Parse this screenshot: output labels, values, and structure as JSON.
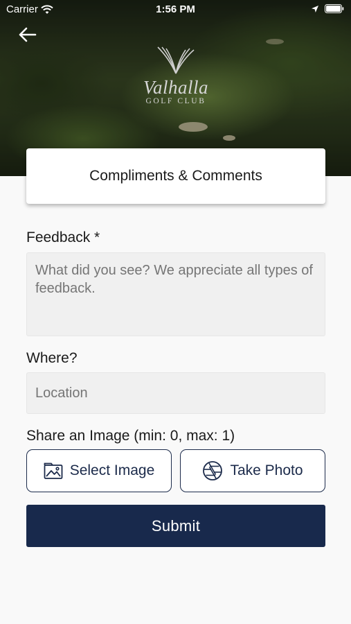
{
  "status_bar": {
    "carrier": "Carrier",
    "time": "1:56 PM"
  },
  "header": {
    "back_icon": "arrow-left-icon",
    "logo_name": "Valhalla",
    "logo_sub": "GOLF CLUB"
  },
  "page": {
    "title": "Compliments & Comments"
  },
  "form": {
    "feedback_label": "Feedback *",
    "feedback_placeholder": "What did you see? We appreciate all types of feedback.",
    "feedback_value": "",
    "where_label": "Where?",
    "location_placeholder": "Location",
    "location_value": "",
    "image_label": "Share an Image (min: 0, max: 1)",
    "select_image_label": "Select Image",
    "select_image_icon": "image-icon",
    "take_photo_label": "Take Photo",
    "take_photo_icon": "camera-aperture-icon",
    "submit_label": "Submit"
  },
  "colors": {
    "primary": "#18294c",
    "background": "#f9f9f9",
    "field_background": "#f0f0f0",
    "placeholder": "#c2c2c2"
  }
}
